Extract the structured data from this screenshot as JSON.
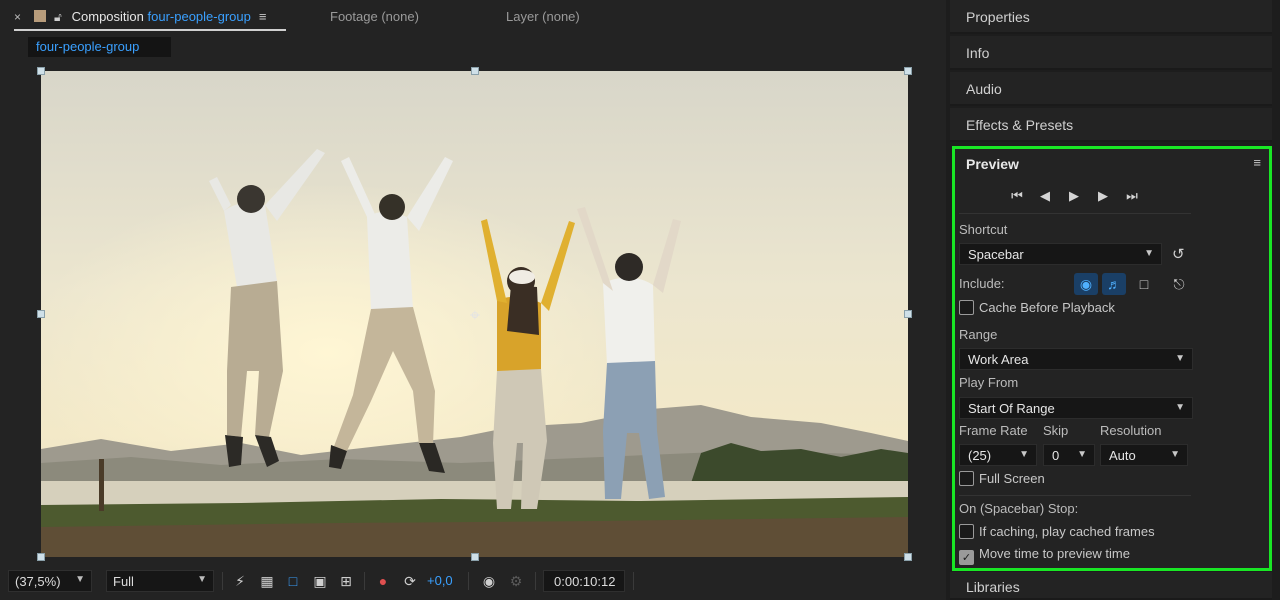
{
  "comp_tabs": {
    "close": "×",
    "composition_prefix": "Composition",
    "composition_name": "four-people-group",
    "footage": "Footage",
    "footage_value": "(none)",
    "layer": "Layer",
    "layer_value": "(none)"
  },
  "comp_chip": "four-people-group",
  "viewer_toolbar": {
    "magnification": "(37,5%)",
    "resolution": "Full",
    "exposure": "+0,0",
    "timecode": "0:00:10:12"
  },
  "panels": {
    "properties": "Properties",
    "info": "Info",
    "audio": "Audio",
    "effects": "Effects & Presets",
    "libraries": "Libraries"
  },
  "preview": {
    "title": "Preview",
    "shortcut_label": "Shortcut",
    "shortcut_value": "Spacebar",
    "include_label": "Include:",
    "cache_before_playback": "Cache Before Playback",
    "range_label": "Range",
    "range_value": "Work Area",
    "play_from_label": "Play From",
    "play_from_value": "Start Of Range",
    "frame_rate_label": "Frame Rate",
    "frame_rate_value": "(25)",
    "skip_label": "Skip",
    "skip_value": "0",
    "resolution_label": "Resolution",
    "resolution_value": "Auto",
    "full_screen": "Full Screen",
    "on_stop_label": "On (Spacebar) Stop:",
    "if_caching": "If caching, play cached frames",
    "move_time": "Move time to preview time",
    "move_time_checked": true,
    "cache_checked": false,
    "full_screen_checked": false,
    "if_caching_checked": false
  },
  "colors": {
    "accent_blue": "#3aa0ff",
    "highlight_green": "#19e625",
    "panel_bg": "#232323"
  }
}
